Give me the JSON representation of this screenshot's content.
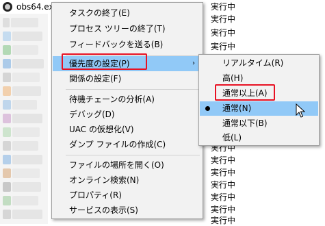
{
  "process": {
    "name": "obs64.exe"
  },
  "status_column": {
    "items": [
      "実行中",
      "実行中",
      "実行中",
      "実行中",
      "実行中",
      "実行中",
      "実行中",
      "実行中",
      "実行中",
      "実行中",
      "実行中",
      "実行中",
      "実行中",
      "実行中"
    ]
  },
  "context_menu": {
    "items": [
      {
        "label": "タスクの終了(E)"
      },
      {
        "label": "プロセス ツリーの終了(T)"
      },
      {
        "label": "フィードバックを送る(B)"
      },
      {
        "label": "優先度の設定(P)",
        "submenu_arrow": "›"
      },
      {
        "label": "関係の設定(F)"
      },
      {
        "label": "待機チェーンの分析(A)"
      },
      {
        "label": "デバッグ(D)"
      },
      {
        "label": "UAC の仮想化(V)"
      },
      {
        "label": "ダンプ ファイルの作成(C)"
      },
      {
        "label": "ファイルの場所を開く(O)"
      },
      {
        "label": "オンライン検索(N)"
      },
      {
        "label": "プロパティ(R)"
      },
      {
        "label": "サービスの表示(S)"
      }
    ]
  },
  "priority_submenu": {
    "selected": "通常(N)",
    "items": [
      {
        "label": "リアルタイム(R)"
      },
      {
        "label": "高(H)"
      },
      {
        "label": "通常以上(A)"
      },
      {
        "label": "通常(N)"
      },
      {
        "label": "通常以下(B)"
      },
      {
        "label": "低(L)"
      }
    ]
  },
  "colors": {
    "highlight": "#91c9f7",
    "annotation_box": "#e81123",
    "menu_background": "#f2f2f2"
  },
  "icons": {
    "process_icon": "obs-icon",
    "submenu_arrow": "chevron-right-icon",
    "radio_selected": "radio-dot-icon",
    "cursor": "mouse-pointer-icon"
  }
}
